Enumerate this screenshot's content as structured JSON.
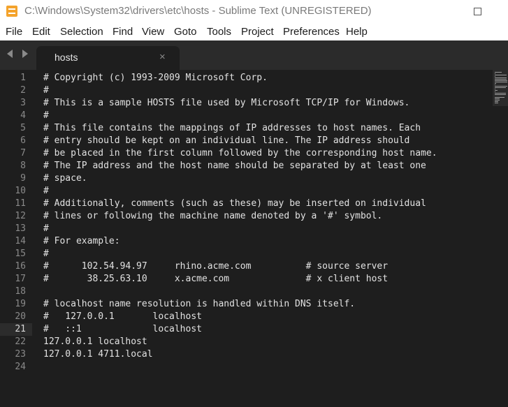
{
  "window": {
    "title": "C:\\Windows\\System32\\drivers\\etc\\hosts - Sublime Text (UNREGISTERED)"
  },
  "menu": [
    "File",
    "Edit",
    "Selection",
    "Find",
    "View",
    "Goto",
    "Tools",
    "Project",
    "Preferences",
    "Help"
  ],
  "tab": {
    "label": "hosts",
    "close_icon": "×"
  },
  "editor": {
    "current_line": 21,
    "lines": [
      "# Copyright (c) 1993-2009 Microsoft Corp.",
      "#",
      "# This is a sample HOSTS file used by Microsoft TCP/IP for Windows.",
      "#",
      "# This file contains the mappings of IP addresses to host names. Each",
      "# entry should be kept on an individual line. The IP address should",
      "# be placed in the first column followed by the corresponding host name.",
      "# The IP address and the host name should be separated by at least one",
      "# space.",
      "#",
      "# Additionally, comments (such as these) may be inserted on individual",
      "# lines or following the machine name denoted by a '#' symbol.",
      "#",
      "# For example:",
      "#",
      "#      102.54.94.97     rhino.acme.com          # source server",
      "#       38.25.63.10     x.acme.com              # x client host",
      "",
      "# localhost name resolution is handled within DNS itself.",
      "#   127.0.0.1       localhost",
      "#   ::1             localhost",
      "127.0.0.1 localhost",
      "127.0.0.1 4711.local",
      ""
    ]
  }
}
